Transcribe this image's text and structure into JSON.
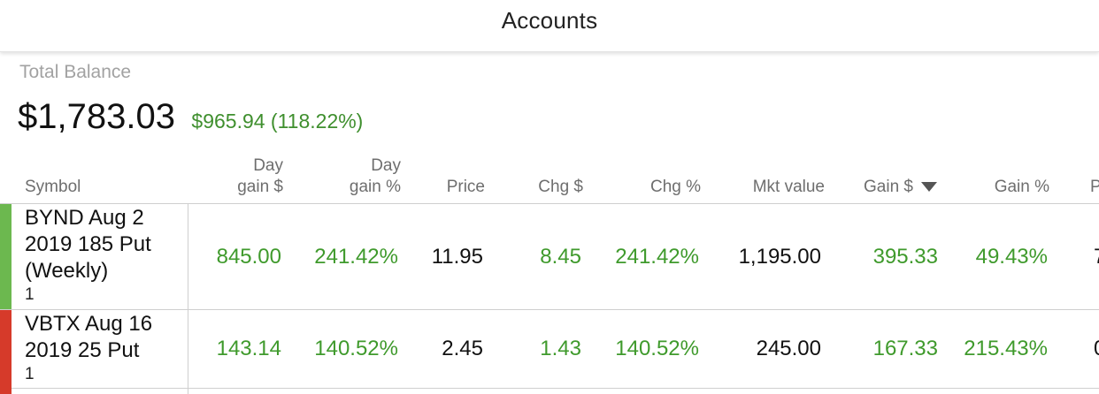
{
  "header": {
    "title": "Accounts"
  },
  "summary": {
    "total_label": "Total Balance",
    "total_amount": "$1,783.03",
    "total_change": "$965.94 (118.22%)"
  },
  "columns": {
    "symbol": "Symbol",
    "day_gain_dollar_line1": "Day",
    "day_gain_dollar_line2": "gain $",
    "day_gain_pct_line1": "Day",
    "day_gain_pct_line2": "gain %",
    "price": "Price",
    "chg_dollar": "Chg $",
    "chg_pct": "Chg %",
    "mkt_value": "Mkt value",
    "gain_dollar": "Gain $",
    "gain_pct": "Gain %",
    "next_partial": "P"
  },
  "rows": [
    {
      "symbol_line1": "BYND Aug 2",
      "symbol_line2": "2019 185 Put",
      "symbol_line3": "(Weekly)",
      "quantity": "1",
      "day_gain_dollar": "845.00",
      "day_gain_pct": "241.42%",
      "price": "11.95",
      "chg_dollar": "8.45",
      "chg_pct": "241.42%",
      "mkt_value": "1,195.00",
      "gain_dollar": "395.33",
      "gain_pct": "49.43%",
      "next_partial": "7",
      "indicator_color": "#6cb84f"
    },
    {
      "symbol_line1": "VBTX Aug 16",
      "symbol_line2": "2019 25 Put",
      "quantity": "1",
      "day_gain_dollar": "143.14",
      "day_gain_pct": "140.52%",
      "price": "2.45",
      "chg_dollar": "1.43",
      "chg_pct": "140.52%",
      "mkt_value": "245.00",
      "gain_dollar": "167.33",
      "gain_pct": "215.43%",
      "next_partial": "0",
      "indicator_color": "#d63a2a"
    }
  ],
  "colors": {
    "gain_green": "#3f9a2c",
    "loss_red": "#d63a2a"
  },
  "icons": {
    "sort": "sort-descending-icon"
  }
}
